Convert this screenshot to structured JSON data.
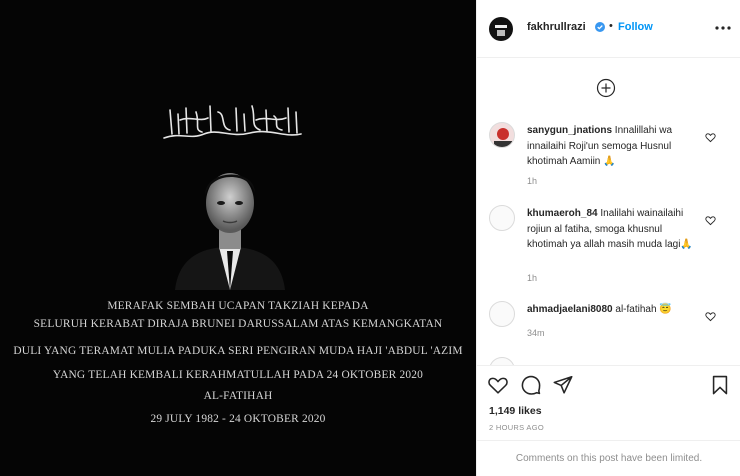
{
  "post": {
    "arabic_calligraphy": "إنا لله وإنا إليه راجعون",
    "lines": [
      "MERAFAK SEMBAH UCAPAN TAKZIAH KEPADA",
      "SELURUH KERABAT DIRAJA BRUNEI DARUSSALAM ATAS KEMANGKATAN",
      "DULI YANG TERAMAT MULIA PADUKA SERI PENGIRAN MUDA HAJI 'ABDUL 'AZIM",
      "YANG TELAH KEMBALI KERAHMATULLAH PADA 24 OKTOBER 2020",
      "AL-FATIHAH",
      "29 JULY 1982 - 24 OKTOBER 2020"
    ]
  },
  "header": {
    "username": "fakhrullrazi",
    "separator": "•",
    "follow_label": "Follow",
    "more_icon": "more-horizontal-icon"
  },
  "comments": [
    {
      "username": "sanygun_jnations",
      "text": "Innalillahi wa innailaihi Roji'un semoga Husnul khotimah Aamiin 🙏",
      "time": "1h"
    },
    {
      "username": "khumaeroh_84",
      "text": "Inalilahi wainailaihi rojiun al fatiha, smoga khusnul khotimah ya allah masih muda lagi🙏",
      "time": "1h"
    },
    {
      "username": "ahmadjaelani8080",
      "text": "al-fatihah 😇",
      "time": "34m"
    }
  ],
  "footer": {
    "likes": "1,149 likes",
    "time_ago": "2 HOURS AGO",
    "comments_limited": "Comments on this post have been limited."
  },
  "colors": {
    "accent": "#0095f6",
    "muted": "#8e8e8e",
    "text": "#262626",
    "image_bg": "#050505"
  }
}
